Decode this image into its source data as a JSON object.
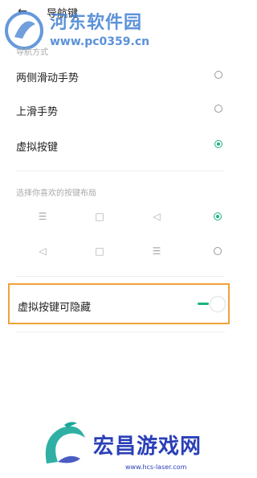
{
  "header": {
    "back_icon": "←",
    "title": "导航键"
  },
  "watermark_top": {
    "title": "河东软件园",
    "url": "www.pc0359.cn"
  },
  "nav_mode": {
    "section_label": "导航方式",
    "options": [
      {
        "label": "两侧滑动手势",
        "checked": false
      },
      {
        "label": "上滑手势",
        "checked": false
      },
      {
        "label": "虚拟按键",
        "checked": true
      }
    ]
  },
  "button_layout": {
    "section_label": "选择你喜欢的按键布局",
    "rows": [
      {
        "icons": [
          "☰",
          "□",
          "◁"
        ],
        "icon_names": [
          "menu-icon",
          "home-square-icon",
          "back-triangle-icon"
        ],
        "checked": true
      },
      {
        "icons": [
          "◁",
          "□",
          "☰"
        ],
        "icon_names": [
          "back-triangle-icon",
          "home-square-icon",
          "menu-icon"
        ],
        "checked": false
      }
    ]
  },
  "hide_keys": {
    "label": "虚拟按键可隐藏",
    "enabled": true
  },
  "colors": {
    "accent": "#19b47a",
    "highlight": "#f0a23a"
  },
  "watermark_bottom": {
    "title": "宏昌游戏网",
    "url": "www.hcs-laser.com"
  }
}
